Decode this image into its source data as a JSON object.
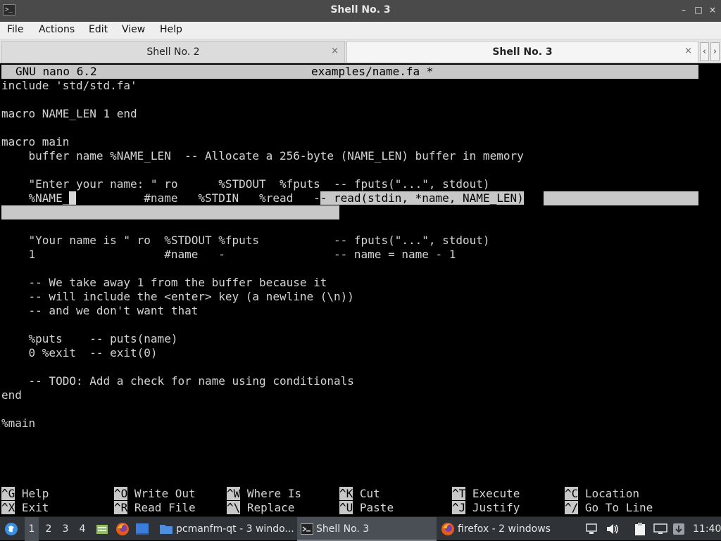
{
  "window": {
    "title": "Shell No. 3",
    "app_icon": ">_",
    "controls": [
      "–",
      "□",
      "×"
    ]
  },
  "menu": [
    "File",
    "Actions",
    "Edit",
    "View",
    "Help"
  ],
  "tabs": [
    {
      "label": "Shell No. 2",
      "active": false,
      "close": "×"
    },
    {
      "label": "Shell No. 3",
      "active": true,
      "close": "×"
    }
  ],
  "tab_scroll": {
    "left": "‹",
    "right": "›"
  },
  "nano": {
    "version": "GNU nano 6.2",
    "filename": "examples/name.fa *",
    "lines": [
      "include 'std/std.fa'",
      "",
      "macro NAME_LEN 1 end",
      "",
      "macro main",
      "    buffer name %NAME_LEN  -- Allocate a 256-byte (NAME_LEN) buffer in memory",
      "",
      "    \"Enter your name: \" ro      %STDOUT  %fputs  -- fputs(\"...\", stdout)",
      "",
      "",
      "    \"Your name is \" ro  %STDOUT %fputs           -- fputs(\"...\", stdout)",
      "    1                   #name   -                -- name = name - 1",
      "",
      "    -- We take away 1 from the buffer because it",
      "    -- will include the <enter> key (a newline (\\n))",
      "    -- and we don't want that",
      "",
      "    %puts    -- puts(name)",
      "    0 %exit  -- exit(0)",
      "",
      "    -- TODO: Add a check for name using conditionals",
      "end",
      "",
      "%main"
    ],
    "selected_line": {
      "before_cursor": "    %NAME_",
      "cursor": " ",
      "middle": "          #name   %STDIN   %read   -",
      "selected": "- read(stdin, *name, NAME_LEN)"
    },
    "shortcuts_row1": [
      {
        "key": "^G",
        "label": "Help"
      },
      {
        "key": "^O",
        "label": "Write Out"
      },
      {
        "key": "^W",
        "label": "Where Is"
      },
      {
        "key": "^K",
        "label": "Cut"
      },
      {
        "key": "^T",
        "label": "Execute"
      },
      {
        "key": "^C",
        "label": "Location"
      }
    ],
    "shortcuts_row2": [
      {
        "key": "^X",
        "label": "Exit"
      },
      {
        "key": "^R",
        "label": "Read File"
      },
      {
        "key": "^\\",
        "label": "Replace"
      },
      {
        "key": "^U",
        "label": "Paste"
      },
      {
        "key": "^J",
        "label": "Justify"
      },
      {
        "key": "^/",
        "label": "Go To Line"
      }
    ]
  },
  "taskbar": {
    "desktops": [
      "1",
      "2",
      "3",
      "4"
    ],
    "active_desktop": "1",
    "windows": [
      {
        "label": "pcmanfm-qt - 3 windo...",
        "icon": "folder-icon"
      },
      {
        "label": "Shell No. 3",
        "icon": "terminal-icon",
        "active": true
      },
      {
        "label": "firefox - 2 windows",
        "icon": "firefox-icon"
      }
    ],
    "clock": "11:40"
  },
  "colors": {
    "titlebar": "#4a4a4a",
    "terminal_bg": "#000000",
    "terminal_fg": "#d4d4d4",
    "highlight": "#c8c8c8",
    "taskbar": "#2f3337"
  }
}
